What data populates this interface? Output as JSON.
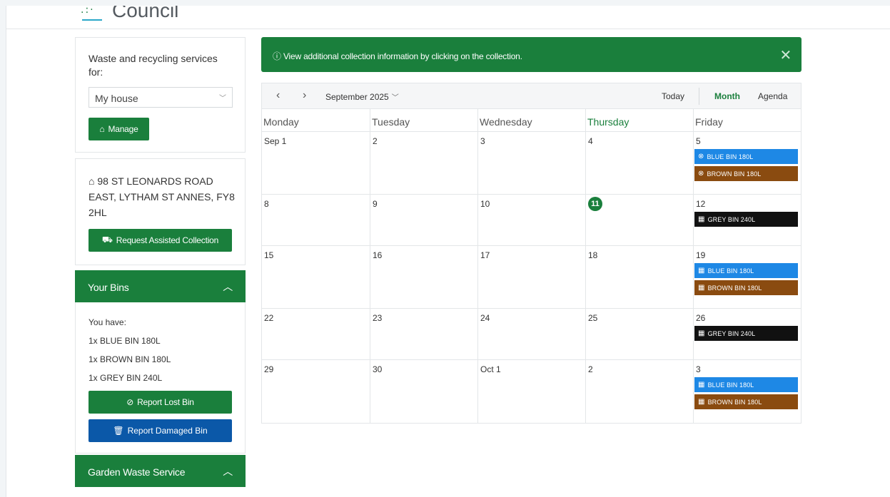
{
  "header": {
    "logo_text": "Council"
  },
  "sidebar": {
    "services_title": "Waste and recycling services for:",
    "property_select": "My house",
    "manage_label": "Manage",
    "address": "98 ST LEONARDS ROAD EAST, LYTHAM ST ANNES, FY8 2HL",
    "assisted_label": "Request Assisted Collection",
    "bins_title": "Your Bins",
    "bins_intro": "You have:",
    "bins": [
      "1x BLUE BIN 180L",
      "1x BROWN BIN 180L",
      "1x GREY BIN 240L"
    ],
    "lost_label": "Report Lost Bin",
    "damaged_label": "Report Damaged Bin",
    "garden_title": "Garden Waste Service"
  },
  "alert": {
    "text": "View additional collection information by clicking on the collection."
  },
  "calendar": {
    "month_label": "September 2025",
    "today_label": "Today",
    "month_view": "Month",
    "agenda_view": "Agenda",
    "weekdays": [
      "Monday",
      "Tuesday",
      "Wednesday",
      "Thursday",
      "Friday"
    ],
    "weeks": [
      [
        "Sep 1",
        "2",
        "3",
        "4",
        "5"
      ],
      [
        "8",
        "9",
        "10",
        "11",
        "12"
      ],
      [
        "15",
        "16",
        "17",
        "18",
        "19"
      ],
      [
        "22",
        "23",
        "24",
        "25",
        "26"
      ],
      [
        "29",
        "30",
        "Oct 1",
        "2",
        "3"
      ]
    ],
    "events": [
      {
        "label": "BLUE BIN 180L",
        "icon": "cancel-icon"
      },
      {
        "label": "BROWN BIN 180L",
        "icon": "cancel-icon"
      },
      {
        "label": "GREY BIN 240L",
        "icon": "calendar-icon"
      },
      {
        "label": "BLUE BIN 180L",
        "icon": "calendar-icon"
      },
      {
        "label": "BROWN BIN 180L",
        "icon": "calendar-icon"
      },
      {
        "label": "GREY BIN 240L",
        "icon": "calendar-icon"
      },
      {
        "label": "BLUE BIN 180L",
        "icon": "calendar-icon"
      },
      {
        "label": "BROWN BIN 180L",
        "icon": "calendar-icon"
      }
    ],
    "colors": {
      "blue": "#1e88e5",
      "brown": "#8a4b10",
      "grey": "#111111",
      "accent": "#1a7f3c"
    }
  }
}
